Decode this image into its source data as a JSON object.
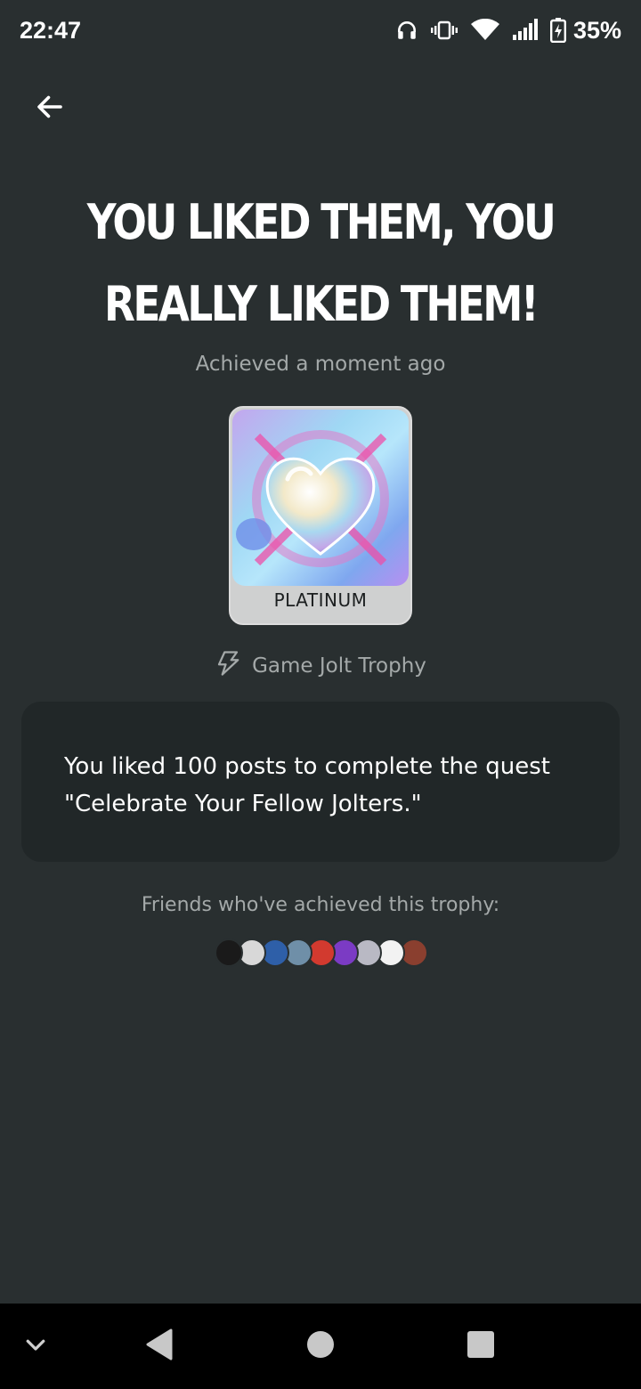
{
  "status_bar": {
    "time": "22:47",
    "battery": "35%",
    "icons": [
      "headphones-icon",
      "vibrate-icon",
      "wifi-icon",
      "signal-icon",
      "battery-charging-icon"
    ]
  },
  "header": {
    "back_icon": "arrow-left-icon"
  },
  "trophy": {
    "title": "YOU LIKED THEM, YOU REALLY LIKED THEM!",
    "achieved": "Achieved a moment ago",
    "tier": "PLATINUM",
    "type_icon": "jolt-bolt-icon",
    "type": "Game Jolt Trophy",
    "description": "You liked 100 posts to complete the quest \"Celebrate Your Fellow Jolters.\""
  },
  "friends": {
    "label": "Friends who've achieved this trophy:",
    "avatars": [
      {
        "color": "#1a1a1a"
      },
      {
        "color": "#d8d8d8"
      },
      {
        "color": "#2e5fa8"
      },
      {
        "color": "#6f8fa8"
      },
      {
        "color": "#d23a2f"
      },
      {
        "color": "#7b3bc4"
      },
      {
        "color": "#b9b9c4"
      },
      {
        "color": "#f2f2f2"
      },
      {
        "color": "#8a3f2f"
      }
    ]
  },
  "nav_bar": {
    "icons": [
      "chevron-down-icon",
      "back-triangle-icon",
      "home-circle-icon",
      "recents-square-icon"
    ]
  },
  "colors": {
    "background": "#292f30",
    "panel": "#212728",
    "muted_text": "#a4a9a9",
    "trophy_frame": "#cfd0d0"
  }
}
